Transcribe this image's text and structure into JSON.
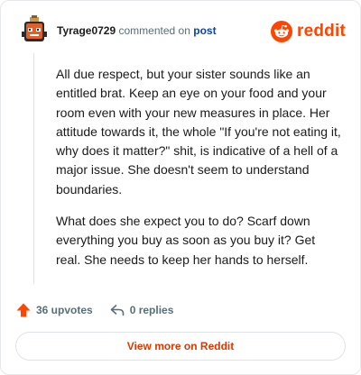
{
  "comment": {
    "username": "Tyrage0729",
    "action_text": "commented on",
    "post_link": "post",
    "paragraphs": [
      "All due respect, but your sister sounds like an entitled brat. Keep an eye on your food and your room even with your new measures in place. Her attitude towards it, the whole \"If you're not eating it, why does it matter?\" shit, is indicative of a hell of a major issue. She doesn't seem to understand boundaries.",
      "What does she expect you to do? Scarf down everything you buy as soon as you buy it? Get real. She needs to keep her hands to herself."
    ],
    "upvotes": "36 upvotes",
    "replies": "0 replies"
  },
  "brand": {
    "wordmark": "reddit",
    "color": "#ff4500"
  },
  "footer": {
    "view_more_label": "View more on Reddit"
  },
  "icons": {
    "upvote": "upvote-arrow-icon",
    "reply": "reply-arrow-icon",
    "brand": "reddit-snoo-icon",
    "avatar": "user-avatar"
  },
  "colors": {
    "upvote_active": "#ff4500",
    "link": "#0a449b",
    "view_more_text": "#d93a00"
  }
}
